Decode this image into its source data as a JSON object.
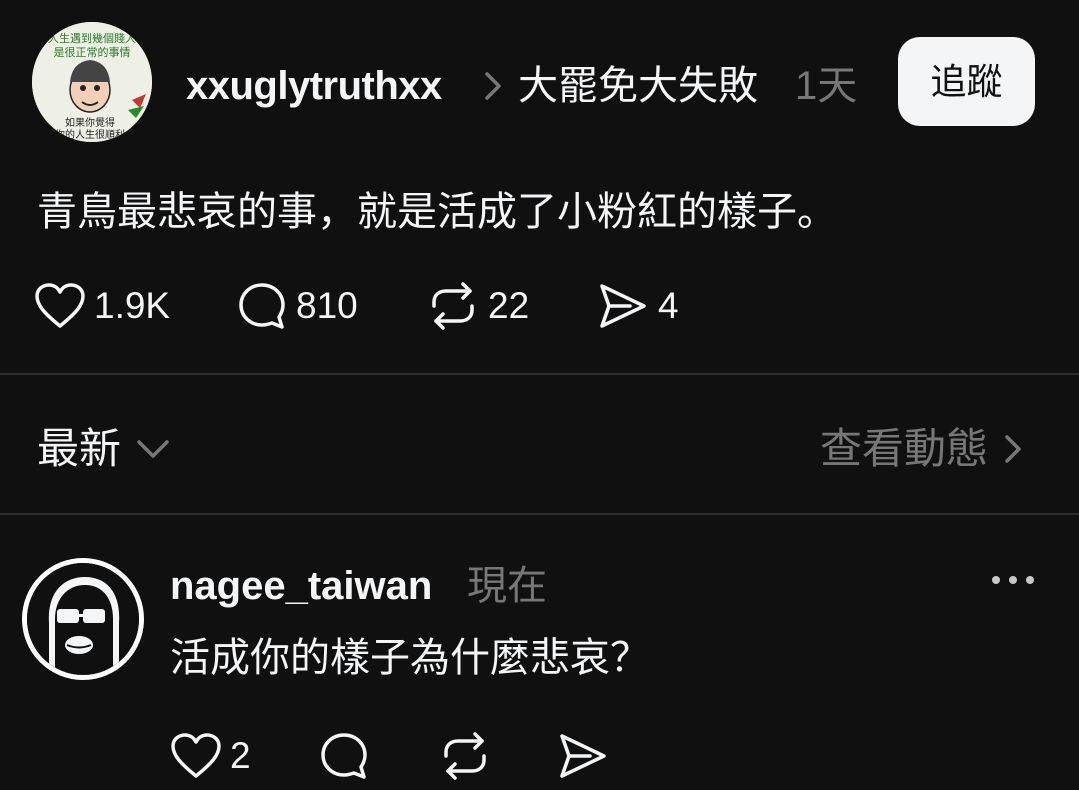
{
  "post": {
    "author": "xxuglytruthxx",
    "topic": "大罷免大失敗",
    "time": "1天",
    "follow_label": "追蹤",
    "avatar_text_line1": "人生遇到幾個賤人",
    "avatar_text_line2": "是很正常的事情",
    "avatar_text_line3": "如果你覺得",
    "avatar_text_line4": "你的人生很順利",
    "text": "青鳥最悲哀的事，就是活成了小粉紅的樣子。",
    "likes": "1.9K",
    "comments": "810",
    "reposts": "22",
    "shares": "4"
  },
  "replies_header": {
    "sort_label": "最新",
    "activity_label": "查看動態"
  },
  "reply": {
    "author": "nagee_taiwan",
    "time": "現在",
    "text": "活成你的樣子為什麼悲哀？",
    "likes": "2"
  },
  "colors": {
    "background": "#101010",
    "text_primary": "#f3f5f7",
    "text_secondary": "#777777",
    "divider": "#2b2b2b",
    "follow_button_bg": "#f3f5f7"
  },
  "icons": [
    "heart-icon",
    "comment-icon",
    "repost-icon",
    "share-icon",
    "chevron-right-icon",
    "chevron-down-icon",
    "more-icon"
  ]
}
